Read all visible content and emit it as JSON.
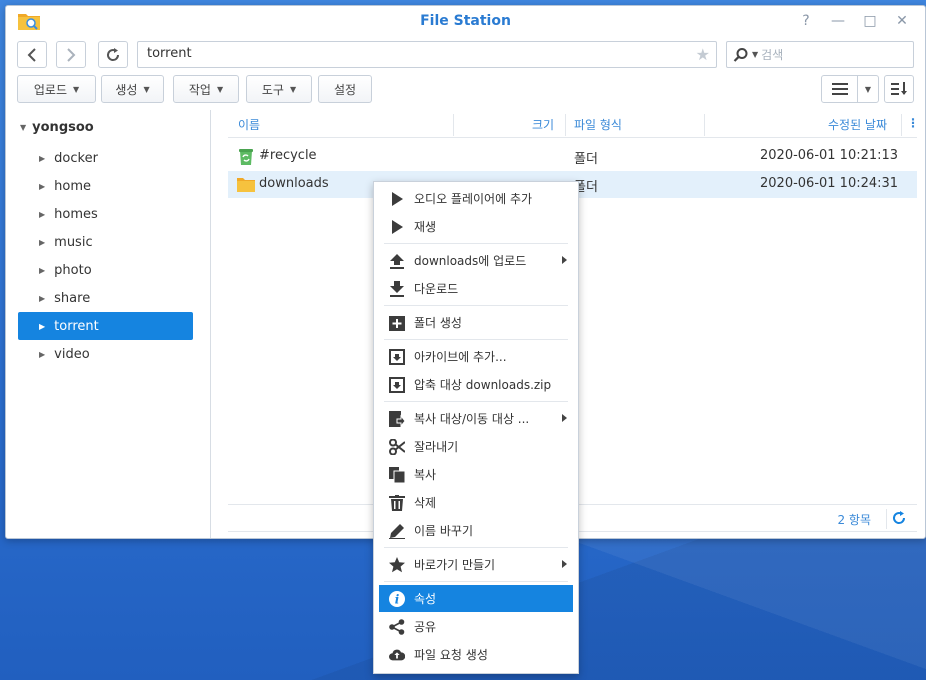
{
  "window": {
    "title": "File Station",
    "controls": {
      "help": "?",
      "minimize": "—",
      "maximize": "□",
      "close": "✕"
    }
  },
  "nav": {
    "path": "torrent",
    "search_placeholder": "검색"
  },
  "toolbar": {
    "upload": "업로드",
    "create": "생성",
    "action": "작업",
    "tools": "도구",
    "settings": "설정"
  },
  "sidebar": {
    "root": "yongsoo",
    "items": [
      {
        "label": "docker"
      },
      {
        "label": "home"
      },
      {
        "label": "homes"
      },
      {
        "label": "music"
      },
      {
        "label": "photo"
      },
      {
        "label": "share"
      },
      {
        "label": "torrent",
        "selected": true
      },
      {
        "label": "video"
      }
    ]
  },
  "columns": {
    "name": "이름",
    "size": "크기",
    "type": "파일 형식",
    "modified": "수정된 날짜"
  },
  "files": [
    {
      "name": "#recycle",
      "type": "폴더",
      "modified": "2020-06-01 10:21:13",
      "icon": "recycle-folder-icon"
    },
    {
      "name": "downloads",
      "type": "폴더",
      "modified": "2020-06-01 10:24:31",
      "icon": "folder-icon"
    }
  ],
  "footer": {
    "count": "2 항목"
  },
  "context_menu": [
    {
      "label": "오디오 플레이어에 추가",
      "icon": "play-icon"
    },
    {
      "label": "재생",
      "icon": "play-icon"
    },
    {
      "label": "downloads에 업로드",
      "icon": "upload-icon",
      "submenu": true
    },
    {
      "label": "다운로드",
      "icon": "download-icon"
    },
    {
      "label": "폴더 생성",
      "icon": "create-folder-icon"
    },
    {
      "label": "아카이브에 추가...",
      "icon": "archive-icon"
    },
    {
      "label": "압축 대상 downloads.zip",
      "icon": "archive-icon"
    },
    {
      "label": "복사 대상/이동 대상 ...",
      "icon": "copy-move-icon",
      "submenu": true
    },
    {
      "label": "잘라내기",
      "icon": "scissors-icon"
    },
    {
      "label": "복사",
      "icon": "copy-icon"
    },
    {
      "label": "삭제",
      "icon": "trash-icon"
    },
    {
      "label": "이름 바꾸기",
      "icon": "pencil-icon"
    },
    {
      "label": "바로가기 만들기",
      "icon": "star-icon",
      "submenu": true
    },
    {
      "label": "속성",
      "icon": "info-icon",
      "active": true
    },
    {
      "label": "공유",
      "icon": "share-icon"
    },
    {
      "label": "파일 요청 생성",
      "icon": "cloud-upload-icon"
    }
  ],
  "colors": {
    "accent": "#1584e0",
    "title": "#2a7bd2"
  }
}
